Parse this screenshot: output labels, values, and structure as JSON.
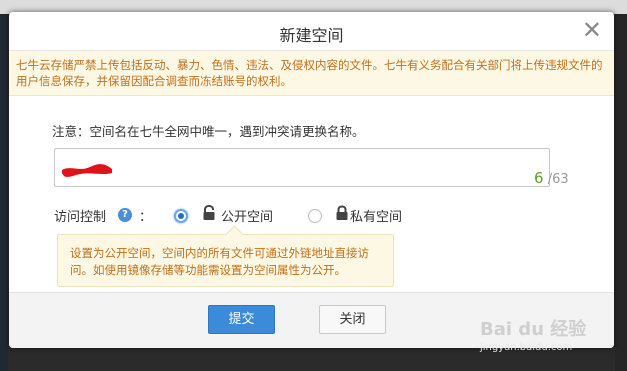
{
  "dialog": {
    "title": "新建空间",
    "close_glyph": "✕",
    "warning": "七牛云存储严禁上传包括反动、暴力、色情、违法、及侵权内容的文件。七牛有义务配合有关部门将上传违规文件的用户信息保存，并保留因配合调查而冻结账号的权利。",
    "note": "注意：空间名在七牛全网中唯一，遇到冲突请更换名称。",
    "name_field": {
      "value": "",
      "redacted": true
    },
    "counter": {
      "current": "6",
      "max": "/63"
    },
    "access": {
      "label": "访问控制",
      "help_icon": "question-icon",
      "colon": "：",
      "options": [
        {
          "label": "公开空间",
          "selected": true,
          "icon": "lock-open-icon"
        },
        {
          "label": "私有空间",
          "selected": false,
          "icon": "lock-icon"
        }
      ],
      "tooltip": "设置为公开空间，空间内的所有文件可通过外链地址直接访问。如使用镜像存储等功能需设置为空间属性为公开。"
    },
    "buttons": {
      "submit": "提交",
      "close": "关闭"
    }
  },
  "watermark": {
    "logo": "Bai du 经验",
    "url": "jingyan.baidu.com"
  },
  "colors": {
    "accent": "#3b8bd8",
    "warning_text": "#c06f1e",
    "counter": "#5aa226"
  }
}
